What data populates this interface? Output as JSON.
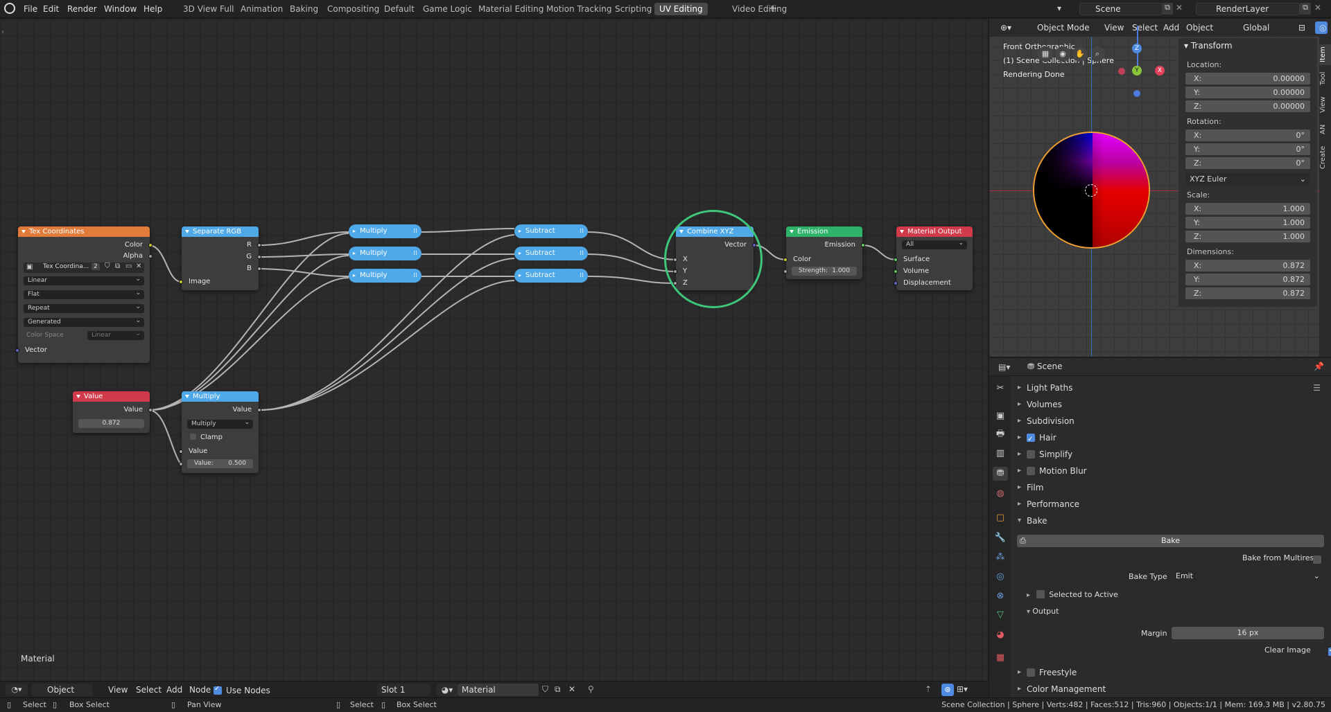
{
  "topbar": {
    "menus": [
      "File",
      "Edit",
      "Render",
      "Window",
      "Help"
    ],
    "workspaces": [
      "3D View Full",
      "Animation",
      "Baking",
      "Compositing",
      "Default",
      "Game Logic",
      "Material Editing",
      "Motion Tracking",
      "Scripting",
      "UV Editing",
      "Video Editing"
    ],
    "active_workspace": "UV Editing",
    "scene": "Scene",
    "view_layer": "RenderLayer"
  },
  "nodes": {
    "tex_coord": {
      "title": "Tex Coordinates",
      "out_color": "Color",
      "out_alpha": "Alpha",
      "image_name": "Tex Coordina...",
      "users": "2",
      "interp": "Linear",
      "projection": "Flat",
      "extension": "Repeat",
      "source": "Generated",
      "colorspace_label": "Color Space",
      "colorspace": "Linear",
      "in_vector": "Vector"
    },
    "separate_rgb": {
      "title": "Separate RGB",
      "out_r": "R",
      "out_g": "G",
      "out_b": "B",
      "in_image": "Image"
    },
    "multiply_collapsed": [
      "Multiply",
      "Multiply",
      "Multiply"
    ],
    "subtract_collapsed": [
      "Subtract",
      "Subtract",
      "Subtract"
    ],
    "combine_xyz": {
      "title": "Combine XYZ",
      "out_vector": "Vector",
      "in_x": "X",
      "in_y": "Y",
      "in_z": "Z"
    },
    "emission": {
      "title": "Emission",
      "out": "Emission",
      "in_color": "Color",
      "strength_label": "Strength:",
      "strength": "1.000"
    },
    "material_output": {
      "title": "Material Output",
      "target": "All",
      "in_surface": "Surface",
      "in_volume": "Volume",
      "in_displacement": "Displacement"
    },
    "value": {
      "title": "Value",
      "out": "Value",
      "value": "0.872"
    },
    "math_multiply": {
      "title": "Multiply",
      "out": "Value",
      "operation": "Multiply",
      "clamp": "Clamp",
      "in_value": "Value",
      "value_label": "Value:",
      "value": "0.500"
    }
  },
  "editor_label": "Material",
  "viewport": {
    "mode": "Object Mode",
    "menus": [
      "View",
      "Select",
      "Add",
      "Object"
    ],
    "orientation": "Global",
    "info_line1": "Front Orthographic",
    "info_line2": "(1) Scene Collection | Sphere",
    "info_line3": "Rendering Done",
    "axis_z": "Z",
    "axis_y": "Y",
    "axis_x": "X"
  },
  "npanel": {
    "header": "Transform",
    "location_label": "Location:",
    "location": [
      {
        "axis": "X:",
        "value": "0.00000"
      },
      {
        "axis": "Y:",
        "value": "0.00000"
      },
      {
        "axis": "Z:",
        "value": "0.00000"
      }
    ],
    "rotation_label": "Rotation:",
    "rotation": [
      {
        "axis": "X:",
        "value": "0°"
      },
      {
        "axis": "Y:",
        "value": "0°"
      },
      {
        "axis": "Z:",
        "value": "0°"
      }
    ],
    "rotation_mode": "XYZ Euler",
    "scale_label": "Scale:",
    "scale": [
      {
        "axis": "X:",
        "value": "1.000"
      },
      {
        "axis": "Y:",
        "value": "1.000"
      },
      {
        "axis": "Z:",
        "value": "1.000"
      }
    ],
    "dimensions_label": "Dimensions:",
    "dimensions": [
      {
        "axis": "X:",
        "value": "0.872"
      },
      {
        "axis": "Y:",
        "value": "0.872"
      },
      {
        "axis": "Z:",
        "value": "0.872"
      }
    ],
    "tabs": [
      "Item",
      "Tool",
      "View",
      "AN",
      "Create"
    ]
  },
  "properties": {
    "context": "Scene",
    "sections": {
      "light_paths": "Light Paths",
      "volumes": "Volumes",
      "subdivision": "Subdivision",
      "hair": "Hair",
      "simplify": "Simplify",
      "motion_blur": "Motion Blur",
      "film": "Film",
      "performance": "Performance",
      "bake": "Bake",
      "freestyle": "Freestyle",
      "color_management": "Color Management"
    },
    "bake_button": "Bake",
    "bake_from_multires": "Bake from Multires",
    "bake_type_label": "Bake Type",
    "bake_type": "Emit",
    "selected_to_active": "Selected to Active",
    "output": "Output",
    "margin_label": "Margin",
    "margin": "16 px",
    "clear_image": "Clear Image"
  },
  "node_header": {
    "object_type": "Object",
    "menus": [
      "View",
      "Select",
      "Add",
      "Node"
    ],
    "use_nodes": "Use Nodes",
    "slot": "Slot 1",
    "material": "Material"
  },
  "status": {
    "select": "Select",
    "box_select": "Box Select",
    "pan_view": "Pan View",
    "select2": "Select",
    "box_select2": "Box Select",
    "info": "Scene Collection | Sphere | Verts:482 | Faces:512 | Tris:960 | Objects:1/1 | Mem: 169.3 MB | v2.80.75"
  },
  "colors": {
    "node_input": "#e07b3a",
    "node_converter": "#4fa8e8",
    "node_shader": "#2fb36a",
    "node_output": "#d03a4a",
    "selection_ring": "#3ec77a",
    "accent": "#4d8ae0"
  }
}
